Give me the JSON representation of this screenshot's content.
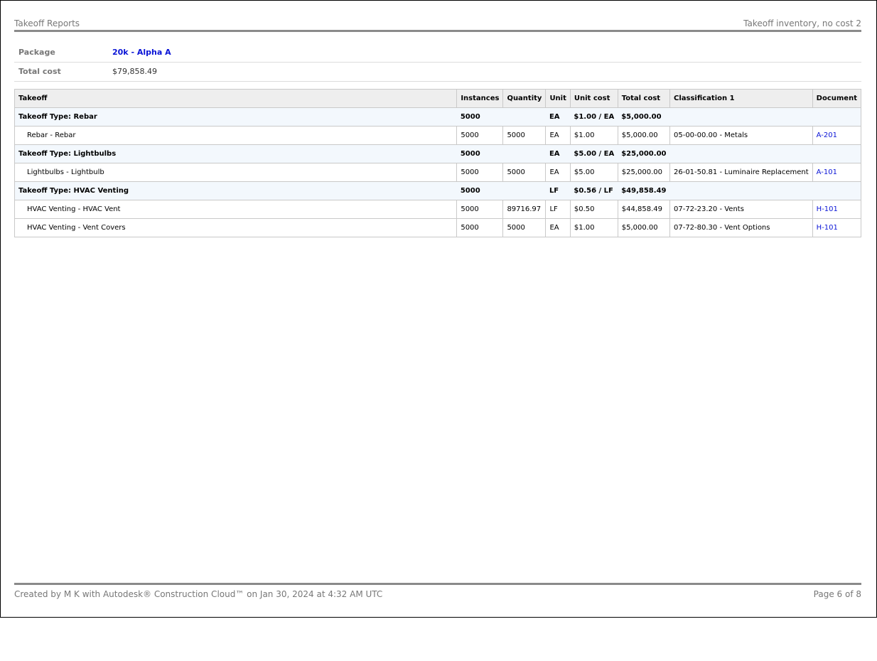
{
  "header": {
    "left": "Takeoff Reports",
    "right": "Takeoff inventory, no cost 2"
  },
  "summary": {
    "package_label": "Package",
    "package_value": "20k - Alpha A",
    "total_cost_label": "Total cost",
    "total_cost_value": "$79,858.49"
  },
  "table": {
    "columns": [
      "Takeoff",
      "Instances",
      "Quantity",
      "Unit",
      "Unit cost",
      "Total cost",
      "Classification 1",
      "Document"
    ],
    "rows": [
      {
        "type": "group",
        "cells": [
          "Takeoff Type: Rebar",
          "5000",
          "",
          "EA",
          "$1.00 / EA",
          "$5,000.00",
          "",
          ""
        ]
      },
      {
        "type": "item",
        "cells": [
          "Rebar - Rebar",
          "5000",
          "5000",
          "EA",
          "$1.00",
          "$5,000.00",
          "05-00-00.00 - Metals",
          "A-201"
        ]
      },
      {
        "type": "group",
        "cells": [
          "Takeoff Type: Lightbulbs",
          "5000",
          "",
          "EA",
          "$5.00 / EA",
          "$25,000.00",
          "",
          ""
        ]
      },
      {
        "type": "item",
        "cells": [
          "Lightbulbs - Lightbulb",
          "5000",
          "5000",
          "EA",
          "$5.00",
          "$25,000.00",
          "26-01-50.81 - Luminaire Replacement",
          "A-101"
        ]
      },
      {
        "type": "group",
        "cells": [
          "Takeoff Type: HVAC Venting",
          "5000",
          "",
          "LF",
          "$0.56 / LF",
          "$49,858.49",
          "",
          ""
        ]
      },
      {
        "type": "item",
        "cells": [
          "HVAC Venting - HVAC Vent",
          "5000",
          "89716.97",
          "LF",
          "$0.50",
          "$44,858.49",
          "07-72-23.20 - Vents",
          "H-101"
        ]
      },
      {
        "type": "item",
        "cells": [
          "HVAC Venting - Vent Covers",
          "5000",
          "5000",
          "EA",
          "$1.00",
          "$5,000.00",
          "07-72-80.30 - Vent Options",
          "H-101"
        ]
      }
    ]
  },
  "footer": {
    "left": "Created by M K  with Autodesk® Construction Cloud™ on Jan 30, 2024 at 4:32 AM UTC",
    "right": "Page 6 of 8"
  }
}
